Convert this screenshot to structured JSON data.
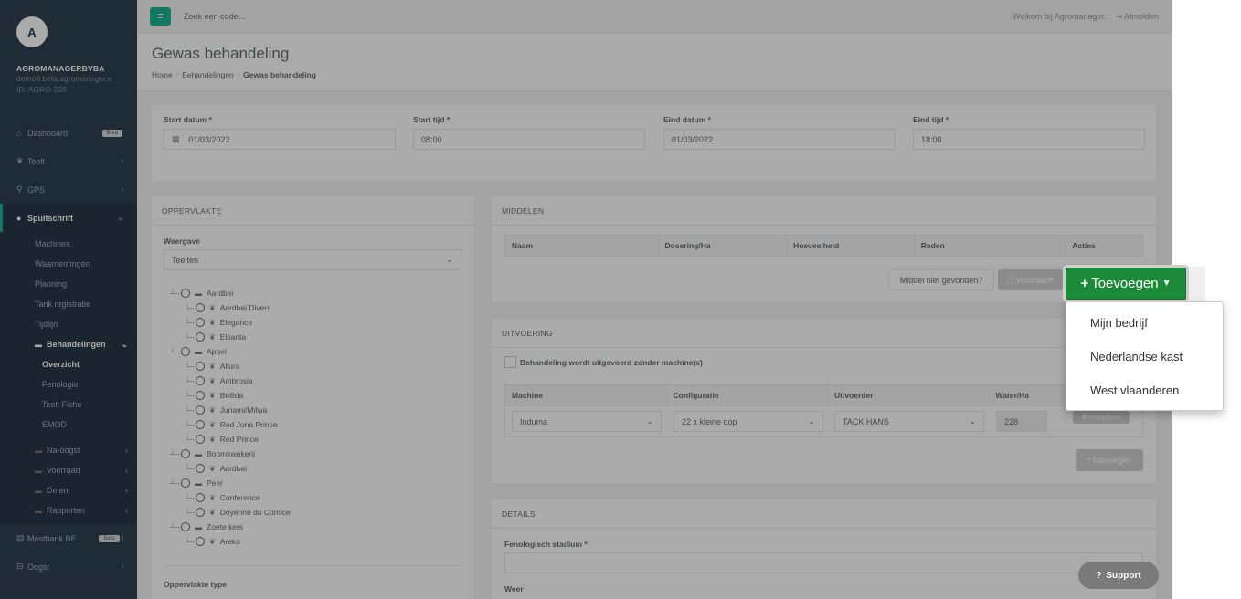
{
  "sidebar": {
    "avatar": "A",
    "company": "AGROMANAGERBVBA",
    "domain": "demo8.beta.agromanager.e",
    "account_id": "ID: AGRO-228",
    "items": [
      {
        "icon": "home-icon",
        "label": "Dashboard",
        "badge": "Beta"
      },
      {
        "icon": "leaf-icon",
        "label": "Teelt"
      },
      {
        "icon": "map-marker-icon",
        "label": "GPS"
      },
      {
        "icon": "tint-icon",
        "label": "Spuitschrift"
      }
    ],
    "sub": [
      "Machines",
      "Waarnemingen",
      "Planning",
      "Tank registratie",
      "Tijdlijn"
    ],
    "behandelingen": "Behandelingen",
    "behandelingen_sub": [
      "Overzicht",
      "Fenologie",
      "Teelt Fiche",
      "EMOD"
    ],
    "folders": [
      "Na-oogst",
      "Voorraad",
      "Delen",
      "Rapporten"
    ],
    "bottom": [
      {
        "icon": "book-icon",
        "label": "Mestbank BE",
        "badge": "Beta"
      },
      {
        "icon": "basket-icon",
        "label": "Oogst"
      }
    ]
  },
  "topbar": {
    "search_placeholder": "Zoek een code...",
    "welcome": "Welkom bij Agromanager.",
    "logout": "Afmelden"
  },
  "heading": {
    "title": "Gewas behandeling",
    "crumbs": [
      "Home",
      "Behandelingen",
      "Gewas behandeling"
    ]
  },
  "dates": {
    "start_datum_label": "Start datum *",
    "start_datum": "01/03/2022",
    "start_tijd_label": "Start tijd *",
    "start_tijd": "08:00",
    "eind_datum_label": "Eind datum *",
    "eind_datum": "01/03/2022",
    "eind_tijd_label": "Eind tijd *",
    "eind_tijd": "18:00"
  },
  "oppervlakte": {
    "title": "OPPERVLAKTE",
    "weergave_label": "Weergave",
    "weergave_value": "Teelten",
    "tree": [
      {
        "level": 0,
        "label": "Aardbei",
        "icon": "folder-icon"
      },
      {
        "level": 1,
        "label": "Aardbei Divers",
        "icon": "leaf-icon"
      },
      {
        "level": 1,
        "label": "Elegance",
        "icon": "leaf-icon"
      },
      {
        "level": 1,
        "label": "Elsanta",
        "icon": "leaf-icon"
      },
      {
        "level": 0,
        "label": "Appel",
        "icon": "folder-icon"
      },
      {
        "level": 1,
        "label": "Allura",
        "icon": "leaf-icon"
      },
      {
        "level": 1,
        "label": "Ambrosia",
        "icon": "leaf-icon"
      },
      {
        "level": 1,
        "label": "Bellida",
        "icon": "leaf-icon"
      },
      {
        "level": 1,
        "label": "Junami/Milwa",
        "icon": "leaf-icon"
      },
      {
        "level": 1,
        "label": "Red Jona Prince",
        "icon": "leaf-icon"
      },
      {
        "level": 1,
        "label": "Red Prince",
        "icon": "leaf-icon"
      },
      {
        "level": 0,
        "label": "Boomkwekerij",
        "icon": "folder-icon"
      },
      {
        "level": 1,
        "label": "Aardbei",
        "icon": "leaf-icon"
      },
      {
        "level": 0,
        "label": "Peer",
        "icon": "folder-icon"
      },
      {
        "level": 1,
        "label": "Conference",
        "icon": "leaf-icon"
      },
      {
        "level": 1,
        "label": "Doyenné du Comice",
        "icon": "leaf-icon"
      },
      {
        "level": 0,
        "label": "Zoete kers",
        "icon": "folder-icon"
      },
      {
        "level": 1,
        "label": "Areko",
        "icon": "leaf-icon"
      }
    ],
    "type_label": "Oppervlakte type"
  },
  "middelen": {
    "title": "MIDDELEN",
    "columns": [
      "Naam",
      "Dosering/Ha",
      "Hoeveelheid",
      "Reden",
      "Acties"
    ],
    "not_found": "Middel niet gevonden?",
    "voorraad": "Voorraad",
    "toevoegen": "Toevoegen"
  },
  "dropdown": {
    "items": [
      "Mijn bedrijf",
      "Nederlandse kast",
      "West vlaanderen"
    ]
  },
  "uitvoering": {
    "title": "UITVOERING",
    "checkbox_label": "Behandeling wordt uitgevoerd zonder machine(s)",
    "columns": [
      "Machine",
      "Configuratie",
      "Uitvoerder",
      "Water/Ha"
    ],
    "row": {
      "machine": "Induma",
      "configuratie": "22 x kleine dop",
      "uitvoerder": "TACK HANS",
      "water": "228",
      "remove": "Verwijderen"
    },
    "toevoegen": "Toevoegen"
  },
  "details": {
    "title": "DETAILS",
    "fenologisch_label": "Fenologisch stadium *",
    "weer_label": "Weer"
  },
  "support": "Support",
  "colors": {
    "sidebar": "#2f4050",
    "accent": "#1ab394",
    "toevoegen": "#1c8b39"
  }
}
